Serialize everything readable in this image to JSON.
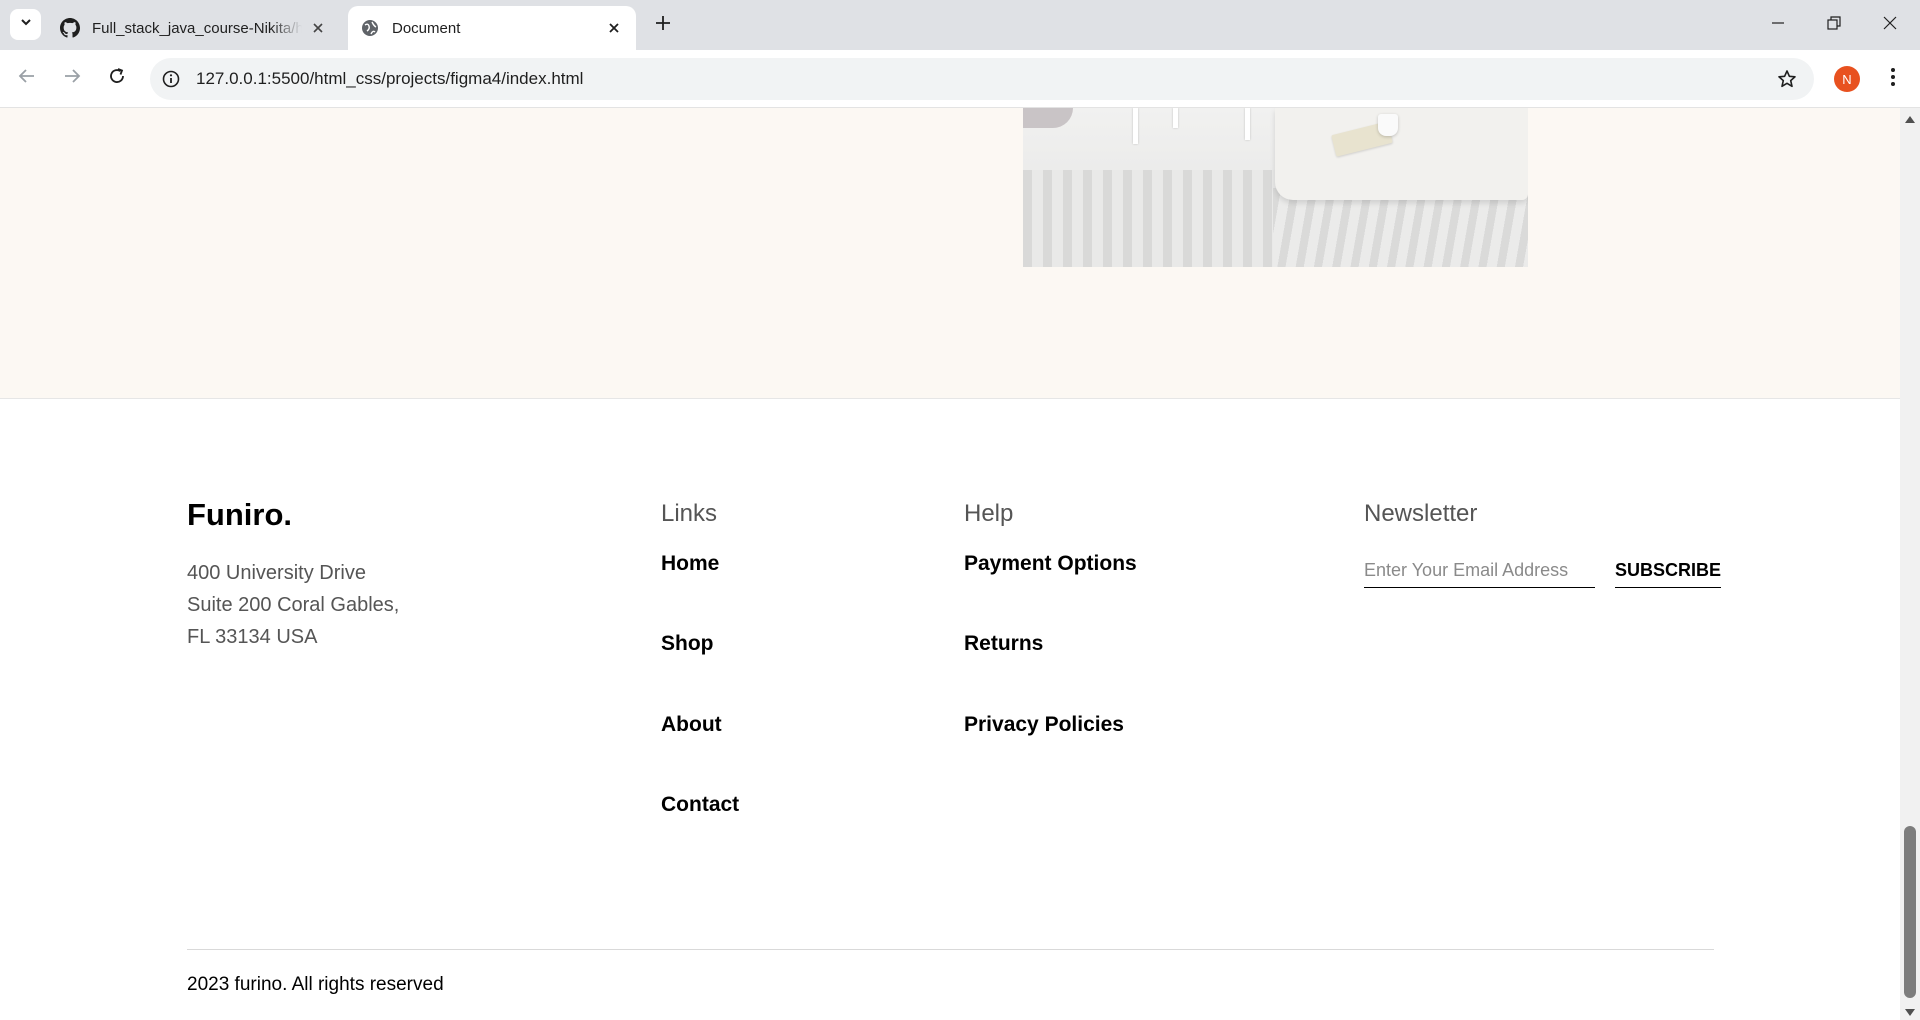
{
  "browser": {
    "tabs": [
      {
        "title": "Full_stack_java_course-Nikita/ht",
        "icon": "github-icon",
        "active": false
      },
      {
        "title": "Document",
        "icon": "globe-icon",
        "active": true
      }
    ],
    "url": "127.0.0.1:5500/html_css/projects/figma4/index.html",
    "profile_initial": "N",
    "accent": "#e8511f"
  },
  "footer": {
    "brand": "Funiro.",
    "address": [
      "400 University Drive",
      "Suite 200 Coral Gables,",
      "FL 33134 USA"
    ],
    "links": {
      "title": "Links",
      "items": [
        "Home",
        "Shop",
        "About",
        "Contact"
      ]
    },
    "help": {
      "title": "Help",
      "items": [
        "Payment Options",
        "Returns",
        "Privacy Policies"
      ]
    },
    "newsletter": {
      "title": "Newsletter",
      "placeholder": "Enter Your Email Address",
      "button": "SUBSCRIBE"
    },
    "copyright": "2023 furino. All rights reserved"
  },
  "colors": {
    "section_bg": "#fcf8f3",
    "muted_text": "#555555"
  }
}
